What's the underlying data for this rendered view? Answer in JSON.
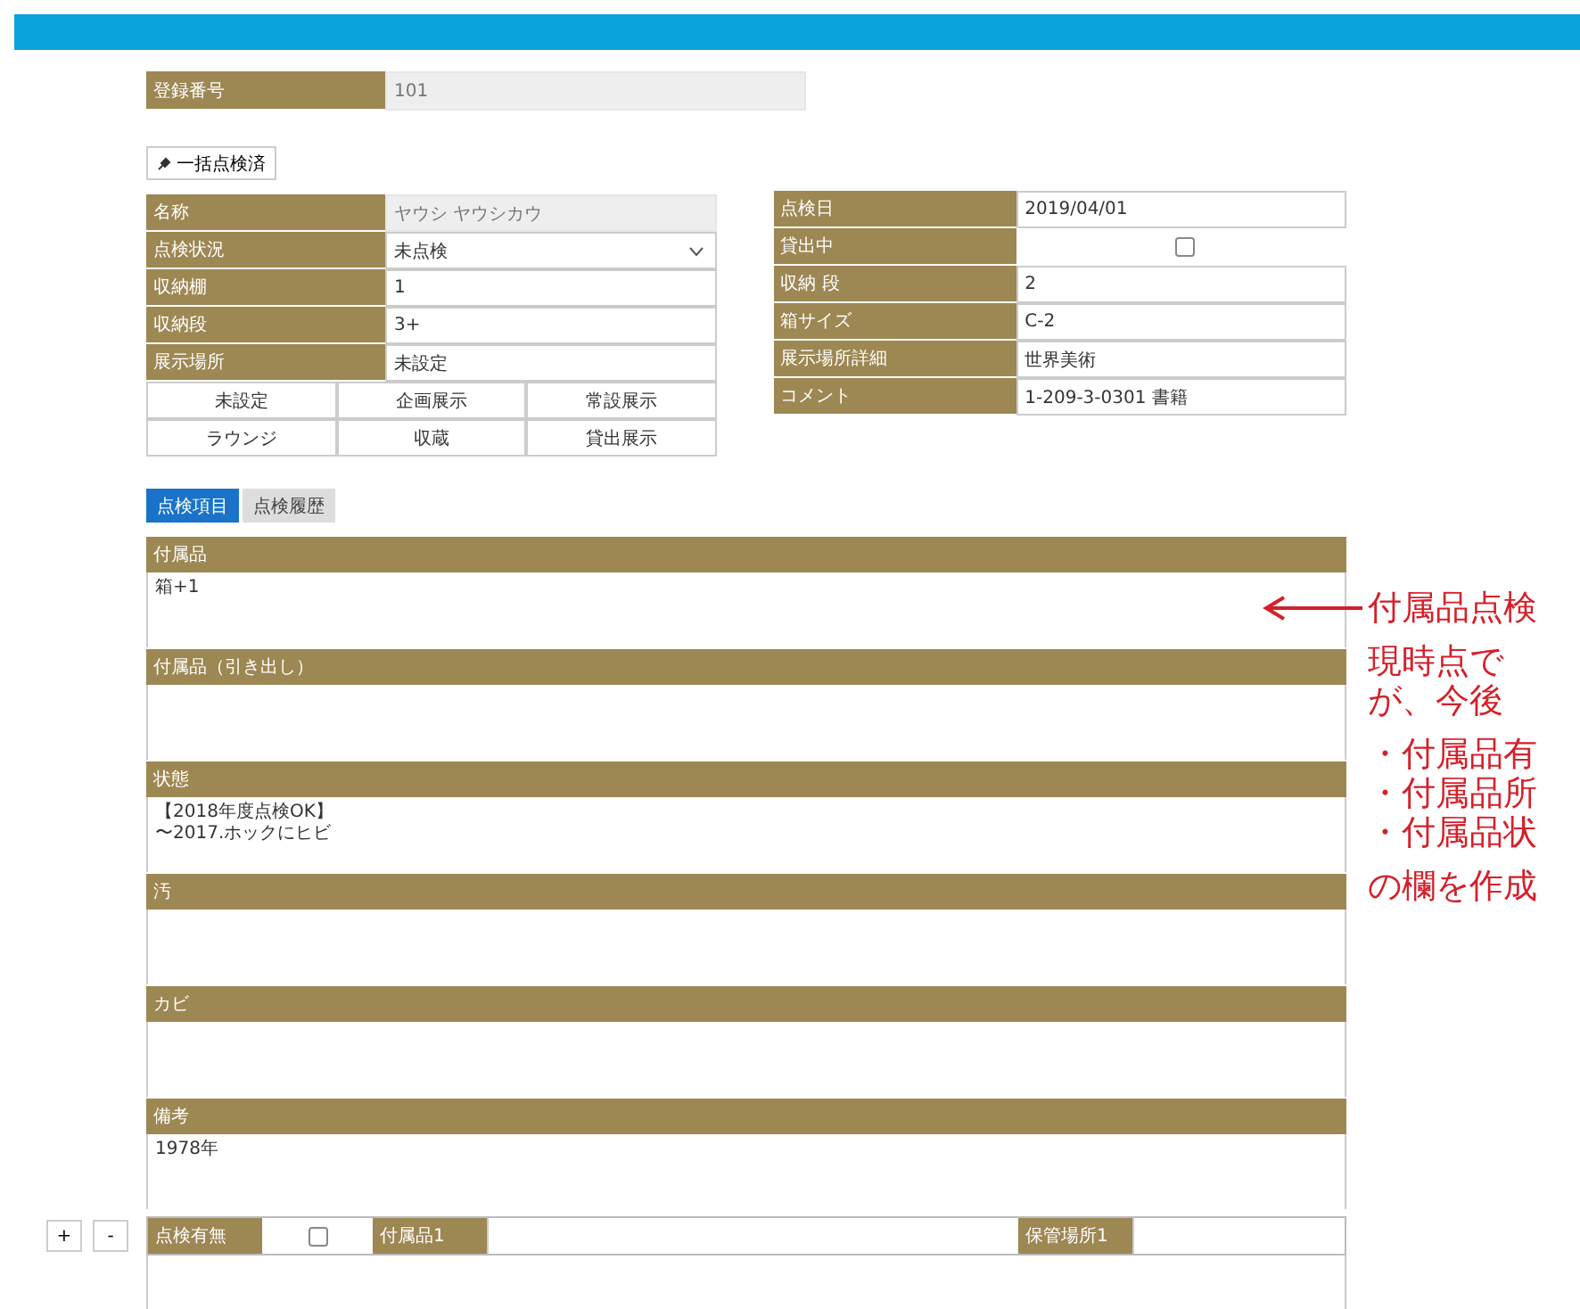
{
  "registration": {
    "label": "登録番号",
    "value": "101"
  },
  "bulk_button": {
    "label": "一括点検済"
  },
  "left_fields": [
    {
      "label": "名称",
      "value": "ヤウシ ヤウシカウ",
      "kind": "readonly"
    },
    {
      "label": "点検状況",
      "value": "未点検",
      "kind": "select"
    },
    {
      "label": "収納棚",
      "value": "1",
      "kind": "text"
    },
    {
      "label": "収納段",
      "value": "3+",
      "kind": "text"
    },
    {
      "label": "展示場所",
      "value": "未設定",
      "kind": "text"
    }
  ],
  "place_buttons": [
    "未設定",
    "企画展示",
    "常設展示",
    "ラウンジ",
    "収蔵",
    "貸出展示"
  ],
  "right_fields": [
    {
      "label": "点検日",
      "value": "2019/04/01",
      "kind": "text"
    },
    {
      "label": "貸出中",
      "kind": "checkbox",
      "checked": false
    },
    {
      "label": "収納 段",
      "value": "2",
      "kind": "text"
    },
    {
      "label": "箱サイズ",
      "value": "C-2",
      "kind": "text"
    },
    {
      "label": "展示場所詳細",
      "value": "世界美術",
      "kind": "text"
    },
    {
      "label": "コメント",
      "value": "1-209-3-0301 書籍",
      "kind": "text"
    }
  ],
  "tabs": [
    {
      "label": "点検項目",
      "selected": true
    },
    {
      "label": "点検履歴",
      "selected": false
    }
  ],
  "sections": [
    {
      "title": "付属品",
      "value": "箱+1"
    },
    {
      "title": "付属品（引き出し）"
    },
    {
      "title": "状態",
      "lines": [
        "【2018年度点検OK】",
        "〜2017.ホックにヒビ"
      ]
    },
    {
      "title": "汚"
    },
    {
      "title": "カビ"
    },
    {
      "title": "備考",
      "value": "1978年"
    }
  ],
  "accessory_row": {
    "add": "+",
    "remove": "-",
    "check_label": "点検有無",
    "checked": false,
    "item_label": "付属品1",
    "place_label": "保管場所1"
  },
  "annotation": {
    "title": "付属品点検",
    "body": [
      "現時点で",
      "が、今後"
    ],
    "bullets": [
      "・付属品有",
      "・付属品所",
      "・付属品状"
    ],
    "closing": "の欄を作成"
  }
}
